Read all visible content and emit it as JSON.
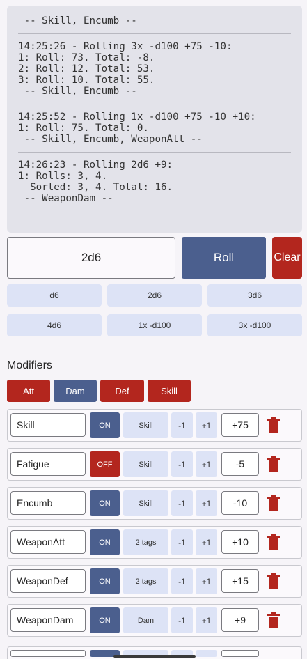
{
  "log": {
    "header": " -- Skill, Encumb --",
    "entries": [
      {
        "lines": [
          "14:25:26 - Rolling 3x -d100 +75 -10:",
          "1: Roll: 73. Total: -8.",
          "2: Roll: 12. Total: 53.",
          "3: Roll: 10. Total: 55.",
          " -- Skill, Encumb --"
        ]
      },
      {
        "lines": [
          "14:25:52 - Rolling 1x -d100 +75 -10 +10:",
          "1: Roll: 75. Total: 0.",
          " -- Skill, Encumb, WeaponAtt --"
        ]
      },
      {
        "lines": [
          "14:26:23 - Rolling 2d6 +9:",
          "1: Rolls: 3, 4.",
          "  Sorted: 3, 4. Total: 16.",
          " -- WeaponDam --"
        ]
      }
    ]
  },
  "dice_input": {
    "value": "2d6"
  },
  "buttons": {
    "roll": "Roll",
    "clear": "Clear"
  },
  "presets": [
    "d6",
    "2d6",
    "3d6",
    "4d6",
    "1x -d100",
    "3x -d100"
  ],
  "modifiers": {
    "title": "Modifiers",
    "tags": [
      {
        "label": "Att",
        "active": false
      },
      {
        "label": "Dam",
        "active": true
      },
      {
        "label": "Def",
        "active": false
      },
      {
        "label": "Skill",
        "active": false
      }
    ],
    "rows": [
      {
        "name": "Skill",
        "state": "ON",
        "category": "Skill",
        "dec": "-1",
        "inc": "+1",
        "value": "+75"
      },
      {
        "name": "Fatigue",
        "state": "OFF",
        "category": "Skill",
        "dec": "-1",
        "inc": "+1",
        "value": "-5"
      },
      {
        "name": "Encumb",
        "state": "ON",
        "category": "Skill",
        "dec": "-1",
        "inc": "+1",
        "value": "-10"
      },
      {
        "name": "WeaponAtt",
        "state": "ON",
        "category": "2 tags",
        "dec": "-1",
        "inc": "+1",
        "value": "+10"
      },
      {
        "name": "WeaponDef",
        "state": "ON",
        "category": "2 tags",
        "dec": "-1",
        "inc": "+1",
        "value": "+15"
      },
      {
        "name": "WeaponDam",
        "state": "ON",
        "category": "Dam",
        "dec": "-1",
        "inc": "+1",
        "value": "+9"
      }
    ]
  },
  "colors": {
    "primary": "#4b5f8e",
    "danger": "#b3261e",
    "chip": "#dde3f6",
    "log_bg": "#e3e3ea"
  },
  "icons": {
    "delete": "trash-icon"
  }
}
